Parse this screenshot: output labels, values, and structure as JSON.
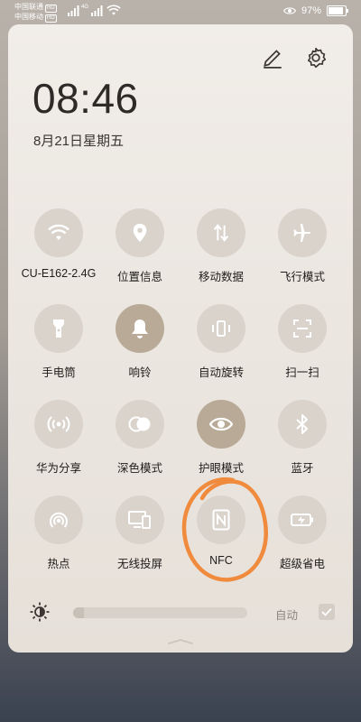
{
  "status_bar": {
    "carrier1": "中国联通",
    "carrier2": "中国移动",
    "hd_tag": "HD",
    "net_tag": "4G",
    "battery": "97%",
    "battery_level": 0.97
  },
  "clock": {
    "time": "08:46",
    "date": "8月21日星期五"
  },
  "toggles": [
    {
      "label": "CU-E162-2.4G",
      "icon": "wifi-icon",
      "on": true
    },
    {
      "label": "位置信息",
      "icon": "location-icon",
      "on": false
    },
    {
      "label": "移动数据",
      "icon": "mobile-data-icon",
      "on": false
    },
    {
      "label": "飞行模式",
      "icon": "airplane-icon",
      "on": false
    },
    {
      "label": "手电筒",
      "icon": "flashlight-icon",
      "on": false
    },
    {
      "label": "响铃",
      "icon": "bell-icon",
      "on": true
    },
    {
      "label": "自动旋转",
      "icon": "rotate-icon",
      "on": false
    },
    {
      "label": "扫一扫",
      "icon": "scan-icon",
      "on": false
    },
    {
      "label": "华为分享",
      "icon": "share-icon",
      "on": false
    },
    {
      "label": "深色模式",
      "icon": "dark-mode-icon",
      "on": false
    },
    {
      "label": "护眼模式",
      "icon": "eye-icon",
      "on": true
    },
    {
      "label": "蓝牙",
      "icon": "bluetooth-icon",
      "on": false
    },
    {
      "label": "热点",
      "icon": "hotspot-icon",
      "on": false
    },
    {
      "label": "无线投屏",
      "icon": "cast-icon",
      "on": false
    },
    {
      "label": "NFC",
      "icon": "nfc-icon",
      "on": false
    },
    {
      "label": "超级省电",
      "icon": "battery-saver-icon",
      "on": false
    }
  ],
  "brightness": {
    "auto_label": "自动",
    "level": 0.06,
    "auto": true
  },
  "colors": {
    "accent_on": "#b8aa96",
    "off": "#d9d3cc",
    "annotation": "#f08a3c"
  }
}
